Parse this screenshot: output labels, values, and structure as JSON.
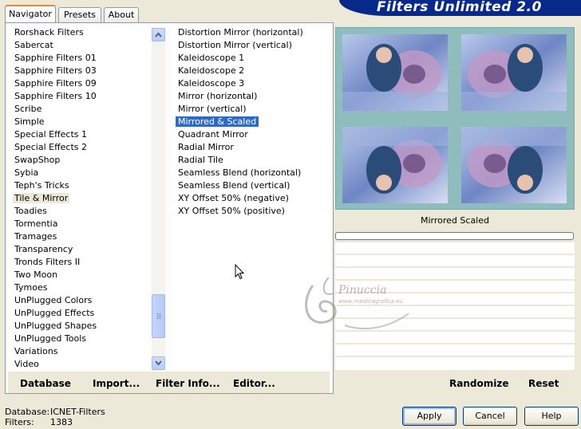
{
  "tabs": {
    "navigator": "Navigator",
    "presets": "Presets",
    "about": "About"
  },
  "title": "Filters Unlimited 2.0",
  "categories": [
    "Rorshack Filters",
    "Sabercat",
    "Sapphire Filters 01",
    "Sapphire Filters 03",
    "Sapphire Filters 09",
    "Sapphire Filters 10",
    "Scribe",
    "Simple",
    "Special Effects 1",
    "Special Effects 2",
    "SwapShop",
    "Sybia",
    "Teph's Tricks",
    "Tile & Mirror",
    "Toadies",
    "Tormentia",
    "Tramages",
    "Transparency",
    "Tronds Filters II",
    "Two Moon",
    "Tymoes",
    "UnPlugged Colors",
    "UnPlugged Effects",
    "UnPlugged Shapes",
    "UnPlugged Tools",
    "Variations",
    "Video"
  ],
  "selected_category": "Tile & Mirror",
  "filters": [
    "Distortion Mirror (horizontal)",
    "Distortion Mirror (vertical)",
    "Kaleidoscope 1",
    "Kaleidoscope 2",
    "Kaleidoscope 3",
    "Mirror (horizontal)",
    "Mirror (vertical)",
    "Mirrored & Scaled",
    "Quadrant Mirror",
    "Radial Mirror",
    "Radial Tile",
    "Seamless Blend (horizontal)",
    "Seamless Blend (vertical)",
    "XY Offset 50% (negative)",
    "XY Offset 50% (positive)"
  ],
  "selected_filter": "Mirrored & Scaled",
  "bottom_left": {
    "database": "Database",
    "import": "Import...",
    "filter_info": "Filter Info...",
    "editor": "Editor..."
  },
  "preview": {
    "filter_name": "Mirrored  Scaled"
  },
  "bottom_right": {
    "randomize": "Randomize",
    "reset": "Reset"
  },
  "status": {
    "database_label": "Database:",
    "database_value": "ICNET-Filters",
    "filters_label": "Filters:",
    "filters_value": "1383"
  },
  "buttons": {
    "apply": "Apply",
    "cancel": "Cancel",
    "help": "Help"
  },
  "watermark": {
    "name": "Pinuccia",
    "site": "www.maidiragrafica.eu"
  },
  "colors": {
    "selection_blue": "#316ac5",
    "banner_blue": "#072a8a",
    "tab_accent": "#e68b2c",
    "preview_bg": "#8fbdbe"
  }
}
